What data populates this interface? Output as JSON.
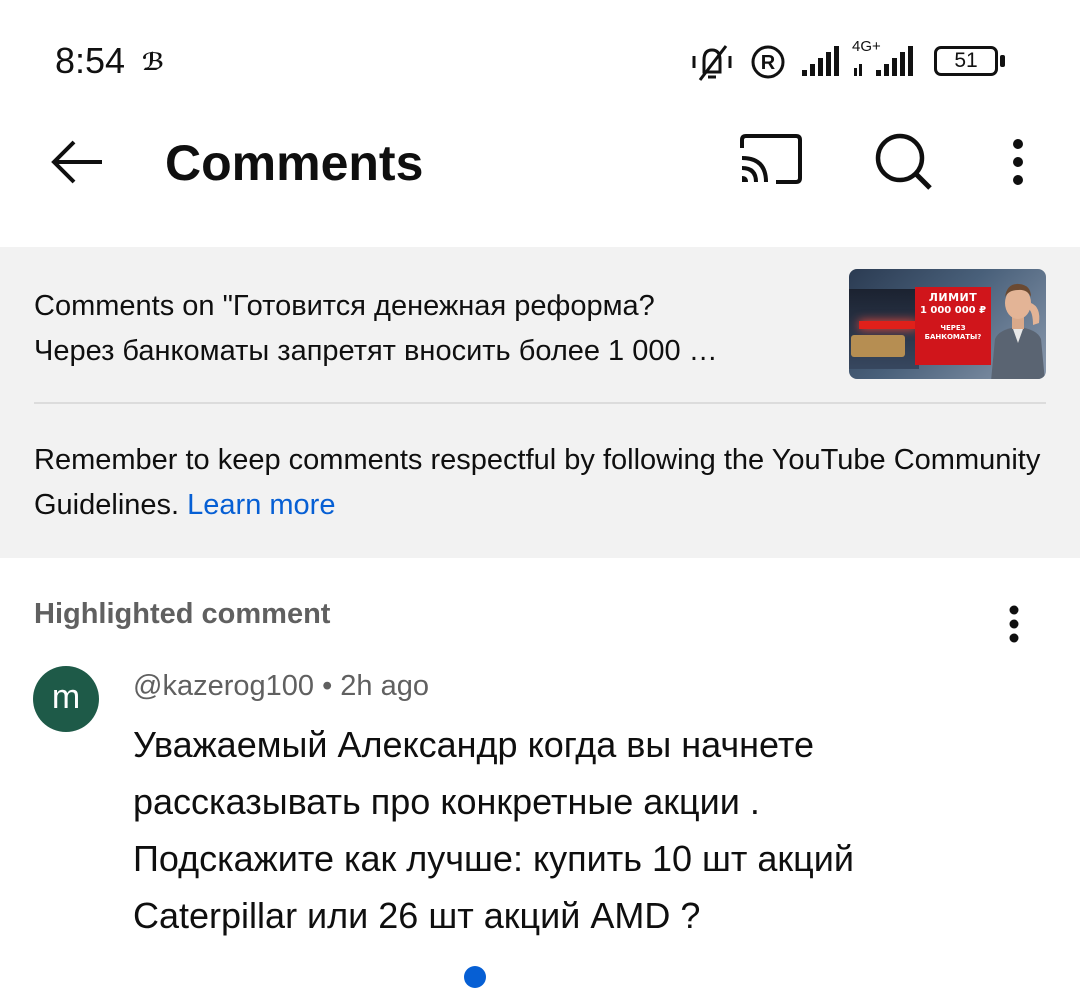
{
  "status_bar": {
    "time": "8:54",
    "carrier_icon": "ℬ",
    "network_label": "4G+",
    "battery": "51",
    "icons": [
      "vibrate-mute-icon",
      "registered-icon",
      "signal-icon",
      "signal-4g-icon",
      "battery-icon"
    ]
  },
  "header": {
    "title": "Comments",
    "back_icon": "arrow-left-icon",
    "cast_icon": "cast-icon",
    "search_icon": "search-icon",
    "more_icon": "more-vertical-icon"
  },
  "info": {
    "video_ref_line1": "Comments on \"Готовится денежная реформа?",
    "video_ref_line2": "Через банкоматы запретят вносить более 1 000 …",
    "thumbnail": {
      "line1": "ЛИМИТ",
      "line2": "1 000 000 ₽",
      "line3": "ЧЕРЕЗ",
      "line4": "БАНКОМАТЫ?"
    },
    "guidelines_text": "Remember to keep comments respectful by following the YouTube Community Guidelines.",
    "learn_more": "Learn more"
  },
  "comment": {
    "section_label": "Highlighted comment",
    "avatar_letter": "m",
    "author": "@kazerog100",
    "separator": "•",
    "time": "2h ago",
    "text_lines": [
      "Уважаемый Александр когда вы начнете",
      "рассказывать про конкретные акции .",
      "Подскажите как лучше: купить 10 шт акций",
      "Caterpillar или 26 шт акций AMD ?"
    ]
  },
  "colors": {
    "link": "#065fd4",
    "panel_bg": "#f2f2f2",
    "avatar_bg": "#1e5a48",
    "secondary_text": "#606060"
  }
}
